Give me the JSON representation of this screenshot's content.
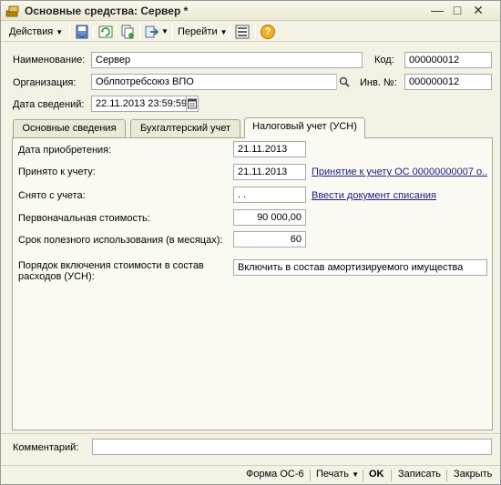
{
  "window": {
    "title": "Основные средства: Сервер *",
    "controls": {
      "minimize": "—",
      "maximize": "□",
      "close": "✕"
    }
  },
  "toolbar": {
    "actions_label": "Действия",
    "goto_label": "Перейти",
    "help_icon": "?"
  },
  "header": {
    "name_label": "Наименование:",
    "name_value": "Сервер",
    "code_label": "Код:",
    "code_value": "000000012",
    "org_label": "Организация:",
    "org_value": "Облпотребсоюз ВПО",
    "inv_label": "Инв. №:",
    "inv_value": "000000012",
    "date_label": "Дата сведений:",
    "date_value": "22.11.2013 23:59:59"
  },
  "tabs": [
    {
      "label": "Основные сведения"
    },
    {
      "label": "Бухгалтерский учет"
    },
    {
      "label": "Налоговый учет (УСН)"
    }
  ],
  "tax_tab": {
    "purchase_date_label": "Дата приобретения:",
    "purchase_date_value": "21.11.2013",
    "accepted_label": "Принято к учету:",
    "accepted_value": "21.11.2013",
    "accepted_link": "Принятие к учету ОС 00000000007 о...",
    "removed_label": "Снято с учета:",
    "removed_value": " .  .",
    "removed_link": "Ввести документ списания",
    "initial_cost_label": "Первоначальная стоимость:",
    "initial_cost_value": "90 000,00",
    "useful_life_label": "Срок полезного использования (в месяцах):",
    "useful_life_value": "60",
    "cost_inclusion_label": "Порядок включения стоимости в состав расходов (УСН):",
    "cost_inclusion_value": "Включить в состав амортизируемого имущества"
  },
  "comment": {
    "label": "Комментарий:",
    "value": ""
  },
  "bottom": {
    "form_os6": "Форма ОС-6",
    "print": "Печать",
    "ok": "OK",
    "save": "Записать",
    "close": "Закрыть"
  },
  "colors": {
    "window_bg": "#f4f2e4",
    "panel_bg": "#fbfaf2",
    "link": "#1b1b8a"
  }
}
